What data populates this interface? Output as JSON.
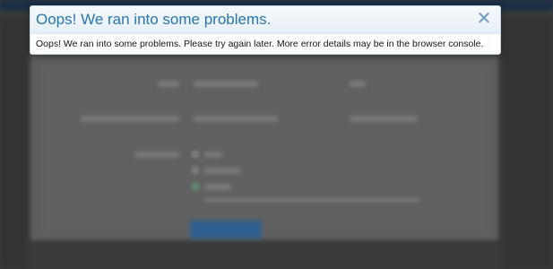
{
  "dialog": {
    "title": "Oops! We ran into some problems.",
    "message": "Oops! We ran into some problems. Please try again later. More error details may be in the browser console.",
    "close_glyph": "✕"
  },
  "colors": {
    "title": "#2577b1",
    "close": "#6e9cc3",
    "overlay": "#2c2c2c"
  }
}
